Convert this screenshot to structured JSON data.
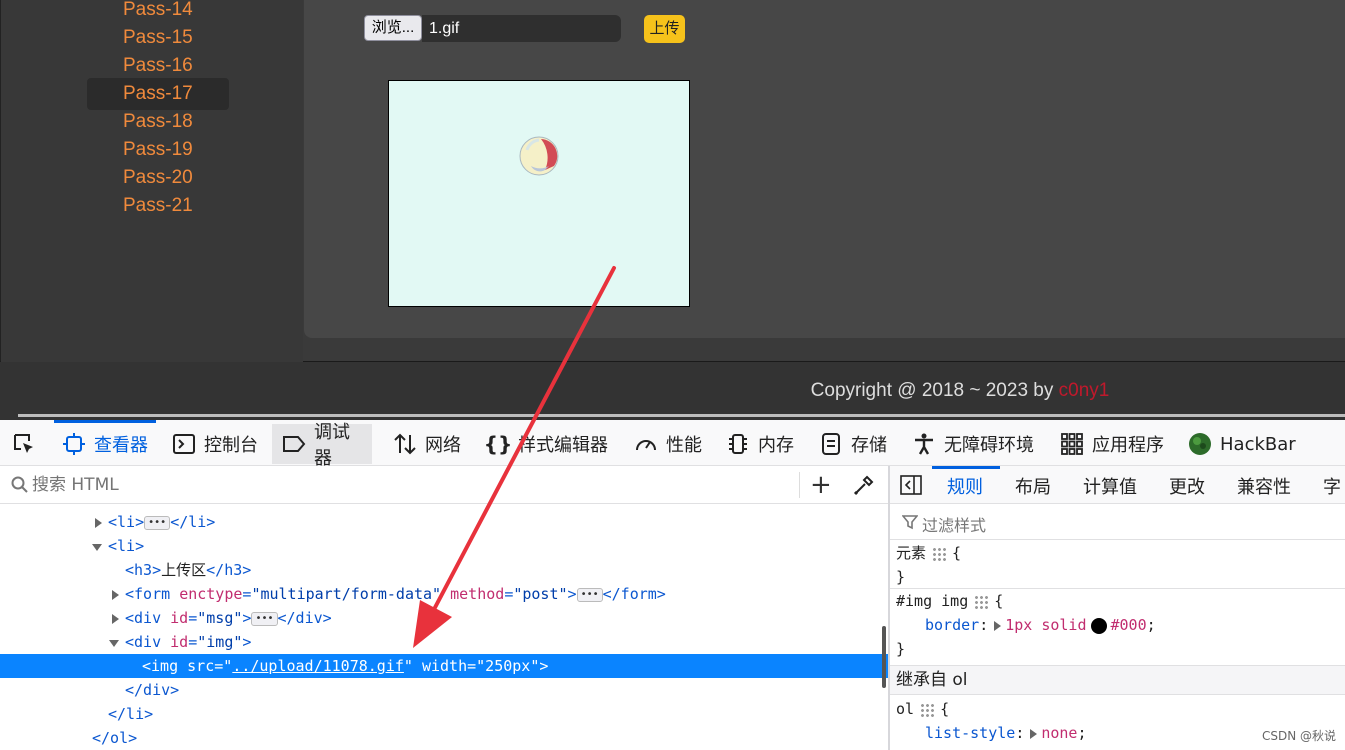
{
  "sidebar": {
    "items": [
      {
        "label": "Pass-14"
      },
      {
        "label": "Pass-15"
      },
      {
        "label": "Pass-16"
      },
      {
        "label": "Pass-17",
        "active": true
      },
      {
        "label": "Pass-18"
      },
      {
        "label": "Pass-19"
      },
      {
        "label": "Pass-20"
      },
      {
        "label": "Pass-21"
      }
    ]
  },
  "upload_form": {
    "browse_label": "浏览...",
    "file_name": "1.gif",
    "upload_label": "上传"
  },
  "footer": {
    "copyright_text": "Copyright @ 2018 ~ 2023 by ",
    "author": "c0ny1"
  },
  "devtools": {
    "tabs": [
      {
        "label": "查看器",
        "icon": "inspector-icon",
        "selected": true
      },
      {
        "label": "控制台",
        "icon": "console-icon"
      },
      {
        "label": "调试器",
        "icon": "debugger-icon"
      },
      {
        "label": "网络",
        "icon": "network-icon"
      },
      {
        "label": "样式编辑器",
        "icon": "style-editor-icon"
      },
      {
        "label": "性能",
        "icon": "performance-icon"
      },
      {
        "label": "内存",
        "icon": "memory-icon"
      },
      {
        "label": "存储",
        "icon": "storage-icon"
      },
      {
        "label": "无障碍环境",
        "icon": "accessibility-icon"
      },
      {
        "label": "应用程序",
        "icon": "application-icon"
      },
      {
        "label": "HackBar",
        "icon": "hackbar-icon"
      }
    ],
    "search_placeholder": "搜索 HTML",
    "add_node": "+",
    "markup": {
      "li_collapsed": {
        "open": "<li>",
        "close": "</li>"
      },
      "li_open": "<li>",
      "h3": {
        "open": "<h3>",
        "text": "上传区",
        "close": "</h3>"
      },
      "form": {
        "tag": "<form",
        "attr1": "enctype",
        "val1": "\"multipart/form-data\"",
        "attr2": "method",
        "val2": "\"post\"",
        "close": "</form>"
      },
      "div_msg": {
        "tag": "<div",
        "attr": "id",
        "val": "\"msg\"",
        "close": "</div>"
      },
      "div_img": {
        "tag": "<div",
        "attr": "id",
        "val": "\"img\"",
        "end": ">"
      },
      "img": {
        "tag": "<img",
        "attr1": "src",
        "val1": "../upload/11078.gif",
        "attr2": "width",
        "val2": "\"250px\"",
        "end": ">"
      },
      "div_close": "</div>",
      "li_close": "</li>",
      "ol_close": "</ol>"
    },
    "rules_tabs": [
      "规则",
      "布局",
      "计算值",
      "更改",
      "兼容性",
      "字"
    ],
    "filter_placeholder": "过滤样式",
    "rules": {
      "element_selector": "元素",
      "img_selector": "#img img",
      "border_prop": "border",
      "border_value": "1px solid",
      "border_color_text": "#000",
      "border_color": "#000000",
      "inherited_header": "继承自 ol",
      "ol_selector": "ol",
      "list_style_prop": "list-style",
      "list_style_value": "none"
    }
  },
  "watermark": "CSDN @秋说",
  "colors": {
    "pass_link": "#f08a3c",
    "upload_button": "#f6c21b",
    "devtools_accent": "#0060df",
    "selection": "#0a84ff",
    "annotation_arrow": "#e8323c"
  }
}
